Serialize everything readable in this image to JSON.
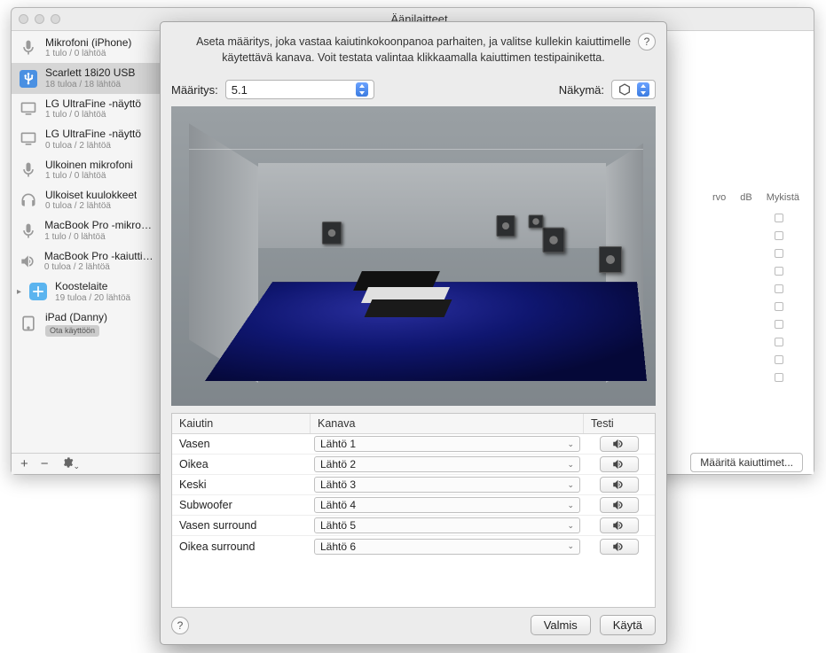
{
  "window": {
    "title": "Äänilaitteet"
  },
  "devices": [
    {
      "name": "Mikrofoni (iPhone)",
      "sub": "1 tulo / 0 lähtöä",
      "icon": "mic"
    },
    {
      "name": "Scarlett 18i20 USB",
      "sub": "18 tuloa / 18 lähtöä",
      "icon": "usb",
      "selected": true
    },
    {
      "name": "LG UltraFine -näyttö",
      "sub": "1 tulo / 0 lähtöä",
      "icon": "display"
    },
    {
      "name": "LG UltraFine -näyttö",
      "sub": "0 tuloa / 2 lähtöä",
      "icon": "display"
    },
    {
      "name": "Ulkoinen mikrofoni",
      "sub": "1 tulo / 0 lähtöä",
      "icon": "mic"
    },
    {
      "name": "Ulkoiset kuulokkeet",
      "sub": "0 tuloa / 2 lähtöä",
      "icon": "headphones"
    },
    {
      "name": "MacBook Pro -mikrofoni",
      "sub": "1 tulo / 0 lähtöä",
      "icon": "mic"
    },
    {
      "name": "MacBook Pro -kaiuttimet",
      "sub": "0 tuloa / 2 lähtöä",
      "icon": "speaker"
    },
    {
      "name": "Koostelaite",
      "sub": "19 tuloa / 20 lähtöä",
      "icon": "aggregate",
      "disclosure": true
    },
    {
      "name": "iPad (Danny)",
      "badge": "Ota käyttöön",
      "icon": "ipad"
    }
  ],
  "bg": {
    "cols": [
      "rvo",
      "dB",
      "Mykistä"
    ],
    "button": "Määritä kaiuttimet..."
  },
  "modal": {
    "instruction": "Aseta määritys, joka vastaa kaiutinkokoonpanoa parhaiten, ja valitse kullekin kaiuttimelle käytettävä kanava. Voit testata valintaa klikkaamalla kaiuttimen testipainiketta.",
    "config_label": "Määritys:",
    "config_value": "5.1",
    "view_label": "Näkymä:",
    "headers": {
      "speaker": "Kaiutin",
      "channel": "Kanava",
      "test": "Testi"
    },
    "rows": [
      {
        "speaker": "Vasen",
        "channel": "Lähtö 1"
      },
      {
        "speaker": "Oikea",
        "channel": "Lähtö 2"
      },
      {
        "speaker": "Keski",
        "channel": "Lähtö 3"
      },
      {
        "speaker": "Subwoofer",
        "channel": "Lähtö 4"
      },
      {
        "speaker": "Vasen surround",
        "channel": "Lähtö 5"
      },
      {
        "speaker": "Oikea surround",
        "channel": "Lähtö 6"
      }
    ],
    "buttons": {
      "done": "Valmis",
      "apply": "Käytä"
    }
  }
}
